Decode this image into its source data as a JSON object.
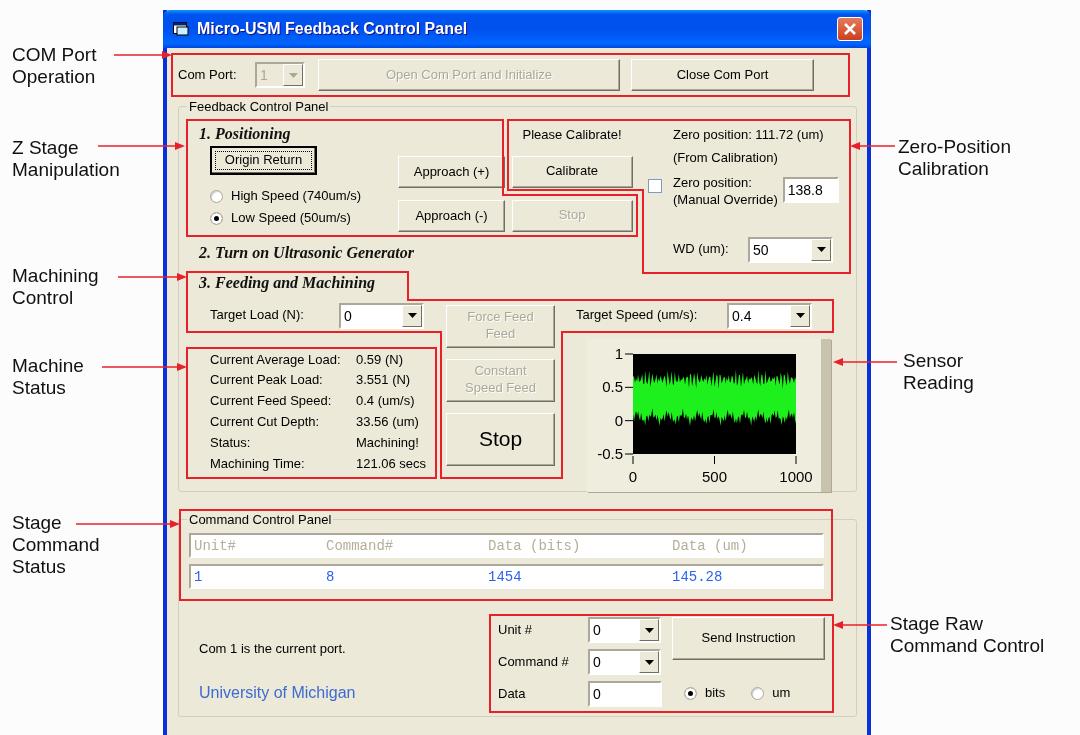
{
  "window": {
    "title": "Micro-USM Feedback Control Panel"
  },
  "com_port": {
    "label": "Com Port:",
    "value": "1",
    "disabled": true,
    "buttons": [
      {
        "label": "Open Com Port and Initialize",
        "disabled": true
      },
      {
        "label": "Close Com Port",
        "disabled": false
      }
    ]
  },
  "feedback_panel": {
    "title": "Feedback Control Panel",
    "positioning": {
      "heading": "1. Positioning",
      "origin_button": {
        "label": "Origin Return",
        "focused": true
      },
      "speeds": [
        {
          "label": "High Speed (740um/s)",
          "selected": false
        },
        {
          "label": "Low Speed (50um/s)",
          "selected": true
        }
      ],
      "approach_buttons": [
        {
          "label": "Approach (+)",
          "disabled": false
        },
        {
          "label": "Approach (-)",
          "disabled": false
        }
      ],
      "stop_button": {
        "label": "Stop",
        "disabled": true
      }
    },
    "calibration": {
      "prompt": "Please Calibrate!",
      "button": {
        "label": "Calibrate",
        "disabled": false
      },
      "zero_position": "Zero position: 111.72 (um)",
      "zero_source": "(From Calibration)",
      "override": {
        "checked": false,
        "label": "Zero position:",
        "sublabel": "(Manual Override)",
        "value": "138.8"
      },
      "wd": {
        "label": "WD (um):",
        "value": "50"
      }
    },
    "step2": "2. Turn on Ultrasonic Generator",
    "machining": {
      "heading": "3. Feeding and Machining",
      "target_load": {
        "label": "Target Load (N):",
        "value": "0"
      },
      "target_speed": {
        "label": "Target Speed (um/s):",
        "value": "0.4"
      },
      "buttons": [
        {
          "label": "Force Feed\nFeed",
          "disabled": true,
          "kind": "normal"
        },
        {
          "label": "Constant\nSpeed Feed",
          "disabled": true,
          "kind": "normal"
        },
        {
          "label": "Stop",
          "disabled": false,
          "kind": "large"
        }
      ],
      "status": [
        {
          "label": "Current Average Load:",
          "value": "0.59 (N)"
        },
        {
          "label": "Current Peak Load:",
          "value": "3.551 (N)"
        },
        {
          "label": "Current Feed Speed:",
          "value": "0.4 (um/s)"
        },
        {
          "label": "Current Cut Depth:",
          "value": "33.56 (um)"
        },
        {
          "label": "Status:",
          "value": "Machining!"
        },
        {
          "label": "Machining Time:",
          "value": "121.06 secs"
        }
      ],
      "sensor": {
        "yticks": [
          "1",
          "0.5",
          "0",
          "-0.5"
        ],
        "xticks": [
          "0",
          "500",
          "1000"
        ]
      }
    }
  },
  "command_panel": {
    "title": "Command Control Panel",
    "columns": [
      "Unit#",
      "Command#",
      "Data (bits)",
      "Data (um)"
    ],
    "row": [
      "1",
      "8",
      "1454",
      "145.28"
    ],
    "port_note": "Com 1 is the current port.",
    "credit": "University of Michigan",
    "raw": {
      "unit": {
        "label": "Unit #",
        "value": "0"
      },
      "command": {
        "label": "Command #",
        "value": "0"
      },
      "data": {
        "label": "Data",
        "value": "0"
      },
      "send": "Send Instruction",
      "units": [
        {
          "label": "bits",
          "selected": true
        },
        {
          "label": "um",
          "selected": false
        }
      ]
    }
  },
  "annotations": [
    {
      "text": "COM Port\nOperation"
    },
    {
      "text": "Z Stage\nManipulation"
    },
    {
      "text": "Machining\nControl"
    },
    {
      "text": "Machine\nStatus"
    },
    {
      "text": "Stage\nCommand\nStatus"
    },
    {
      "text": "Zero-Position\nCalibration"
    },
    {
      "text": "Sensor\nReading"
    },
    {
      "text": "Stage Raw\nCommand Control"
    }
  ]
}
